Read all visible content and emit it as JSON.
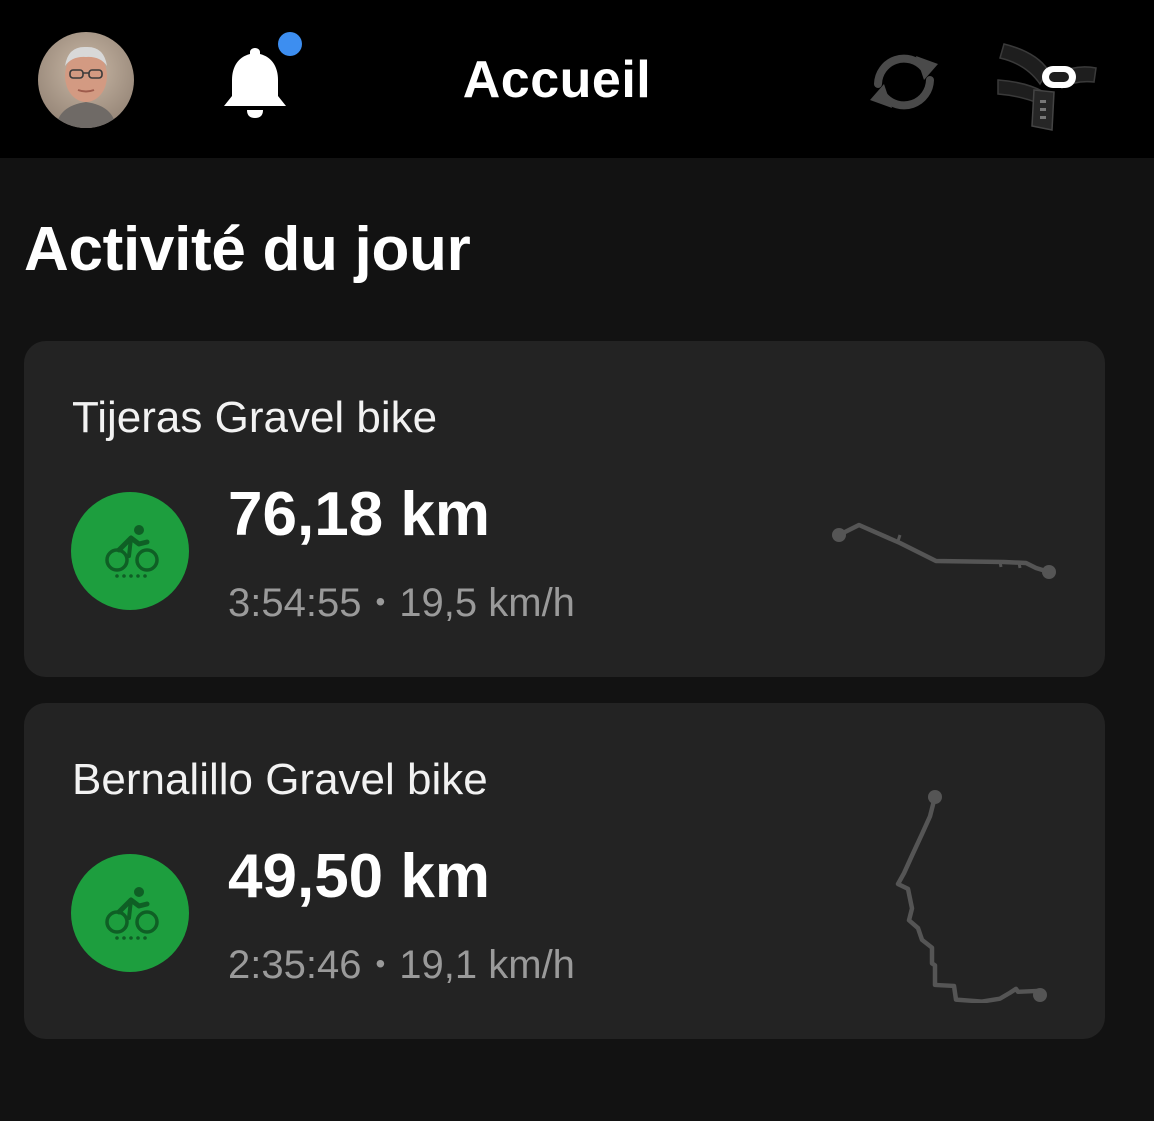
{
  "header": {
    "title": "Accueil",
    "notification_dot_color": "#3d8ef0",
    "icons": [
      "avatar",
      "bell-icon",
      "sync-icon",
      "heart-rate-strap-icon"
    ]
  },
  "section": {
    "title": "Activité du jour"
  },
  "activities": [
    {
      "name": "Tijeras Gravel bike",
      "distance": "76,18 km",
      "duration": "3:54:55",
      "separator": "•",
      "speed": "19,5 km/h",
      "sport_icon": "cycling-icon",
      "badge_color": "#1d9e3e"
    },
    {
      "name": "Bernalillo Gravel bike",
      "distance": "49,50 km",
      "duration": "2:35:46",
      "separator": "•",
      "speed": "19,1 km/h",
      "sport_icon": "cycling-icon",
      "badge_color": "#1d9e3e"
    }
  ],
  "colors": {
    "background": "#121212",
    "topbar": "#000000",
    "card": "#232323",
    "route_line": "#555555",
    "secondary_text": "#9a9a9a"
  }
}
